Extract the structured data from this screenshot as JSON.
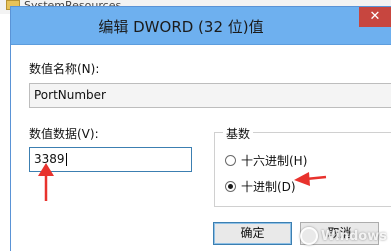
{
  "background": {
    "tree_item_label": "SystemResources"
  },
  "dialog": {
    "title": "编辑 DWORD (32 位)值",
    "close_glyph": "✕"
  },
  "value_name": {
    "label": "数值名称(N):",
    "value": "PortNumber"
  },
  "value_data": {
    "label": "数值数据(V):",
    "value": "3389"
  },
  "base": {
    "title": "基数",
    "options": [
      {
        "label": "十六进制(H)",
        "checked": false
      },
      {
        "label": "十进制(D)",
        "checked": true
      }
    ]
  },
  "buttons": {
    "ok_label": "确定",
    "cancel_label": "取消"
  },
  "annotations": {
    "arrow_color": "#e8322d"
  },
  "watermark": {
    "text": "Windows"
  }
}
